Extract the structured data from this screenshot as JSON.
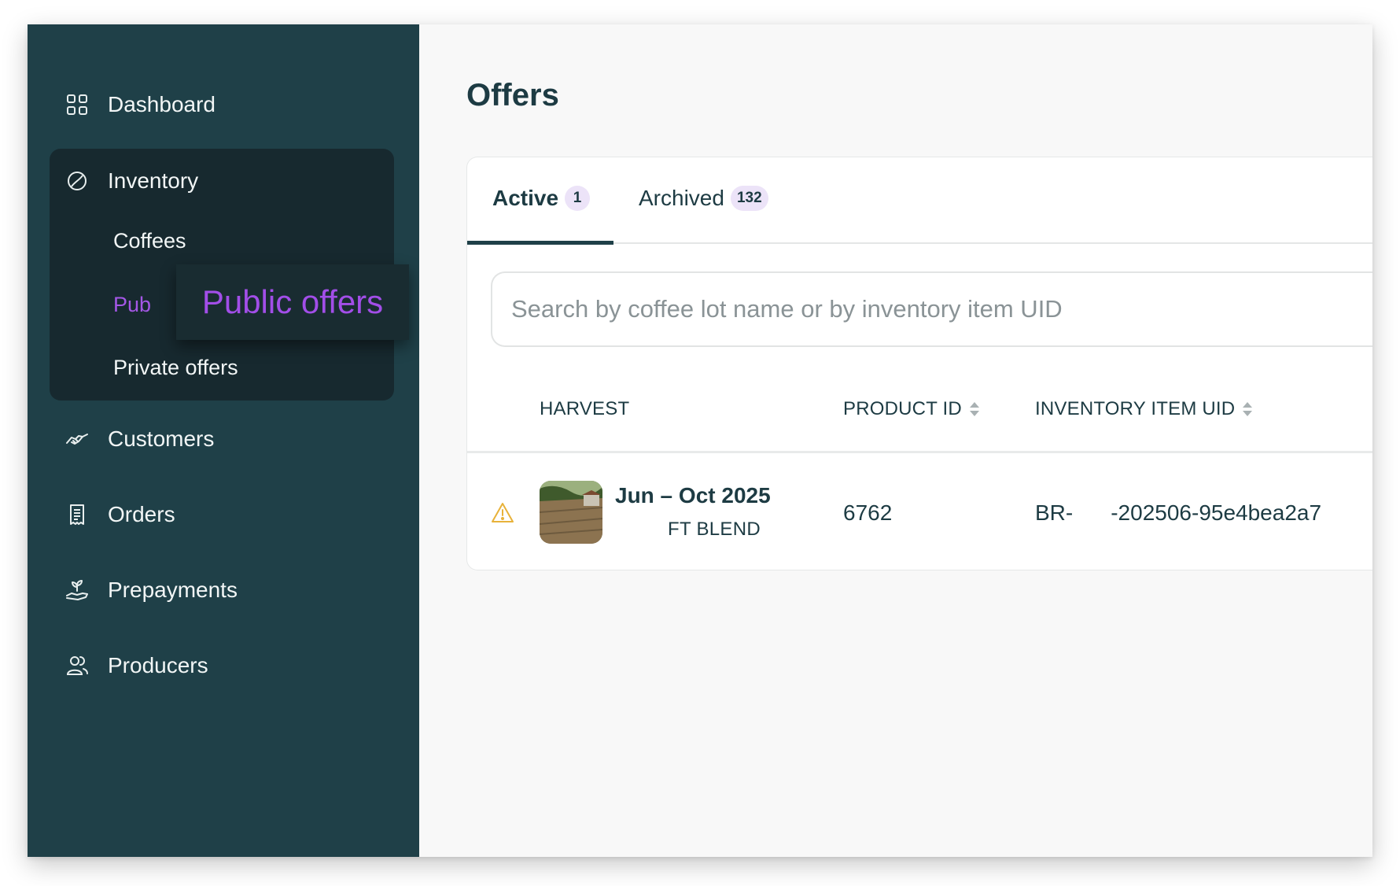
{
  "sidebar": {
    "items": [
      {
        "label": "Dashboard",
        "icon": "grid-icon"
      },
      {
        "label": "Inventory",
        "icon": "coffee-bean-icon"
      },
      {
        "label": "Customers",
        "icon": "handshake-icon"
      },
      {
        "label": "Orders",
        "icon": "receipt-icon"
      },
      {
        "label": "Prepayments",
        "icon": "hand-plant-icon"
      },
      {
        "label": "Producers",
        "icon": "users-icon"
      }
    ],
    "inventory_sub": [
      {
        "label": "Coffees"
      },
      {
        "label": "Pub"
      },
      {
        "label": "Private offers"
      }
    ],
    "tooltip": "Public offers",
    "colors": {
      "background": "#1f4048",
      "group": "#17292f",
      "active_sub": "#a457e6"
    }
  },
  "main": {
    "title": "Offers",
    "tabs": [
      {
        "label": "Active",
        "count": "1"
      },
      {
        "label": "Archived",
        "count": "132"
      }
    ],
    "search": {
      "placeholder": "Search by coffee lot name or by inventory item UID"
    },
    "table": {
      "headers": [
        "HARVEST",
        "PRODUCT ID",
        "INVENTORY ITEM UID"
      ],
      "rows": [
        {
          "harvest_date": "Jun – Oct 2025",
          "harvest_name": "FT BLEND",
          "product_id": "6762",
          "uid_prefix": "BR-",
          "uid_suffix": "-202506-95e4bea2a7",
          "warning_icon": "warning-triangle-icon"
        }
      ]
    }
  }
}
